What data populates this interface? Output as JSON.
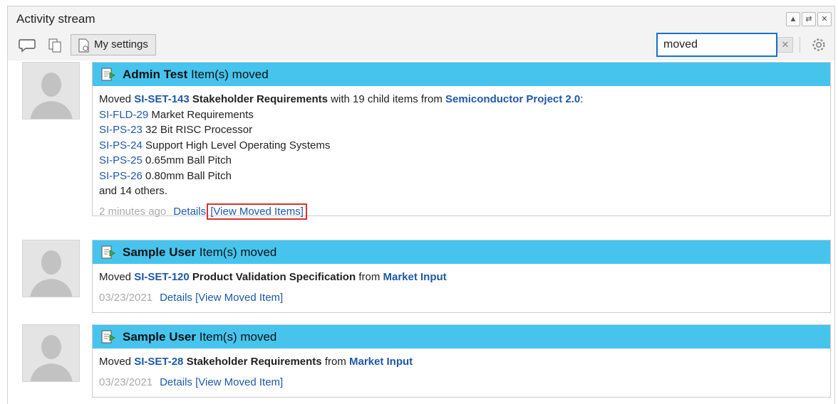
{
  "panel": {
    "title": "Activity stream",
    "window_buttons": [
      "▲",
      "⇄",
      "✕"
    ]
  },
  "toolbar": {
    "settings_label": "My settings",
    "search_value": "moved",
    "clear_label": "✕"
  },
  "entries": [
    {
      "user": "Admin Test",
      "action": "Item(s) moved",
      "text_moved": "Moved",
      "item_id": "SI-SET-143",
      "item_name": "Stakeholder Requirements",
      "text_mid": "with 19 child items from",
      "source": "Semiconductor Project 2.0",
      "text_end": ":",
      "children": [
        {
          "id": "SI-FLD-29",
          "name": "Market Requirements"
        },
        {
          "id": "SI-PS-23",
          "name": "32 Bit RISC Processor"
        },
        {
          "id": "SI-PS-24",
          "name": "Support High Level Operating Systems"
        },
        {
          "id": "SI-PS-25",
          "name": "0.65mm Ball Pitch"
        },
        {
          "id": "SI-PS-26",
          "name": "0.80mm Ball Pitch"
        }
      ],
      "others": "and 14 others.",
      "time": "2 minutes ago",
      "details": "Details",
      "view_link": "[View Moved Items]"
    },
    {
      "user": "Sample User",
      "action": "Item(s) moved",
      "text_moved": "Moved",
      "item_id": "SI-SET-120",
      "item_name": "Product Validation Specification",
      "text_from": "from",
      "source": "Market Input",
      "time": "03/23/2021",
      "details": "Details",
      "view_link": "[View Moved Item]"
    },
    {
      "user": "Sample User",
      "action": "Item(s) moved",
      "text_moved": "Moved",
      "item_id": "SI-SET-28",
      "item_name": "Stakeholder Requirements",
      "text_from": "from",
      "source": "Market Input",
      "time": "03/23/2021",
      "details": "Details",
      "view_link": "[View Moved Item]"
    }
  ],
  "colors": {
    "header_blue": "#46c4ee",
    "link": "#1e58a8",
    "highlight_red": "#d9322c",
    "search_border": "#1a6fce"
  },
  "icons": [
    "comment-icon",
    "copy-icon",
    "settings-doc-icon",
    "gear-icon",
    "moved-item-icon",
    "avatar-placeholder-icon"
  ]
}
